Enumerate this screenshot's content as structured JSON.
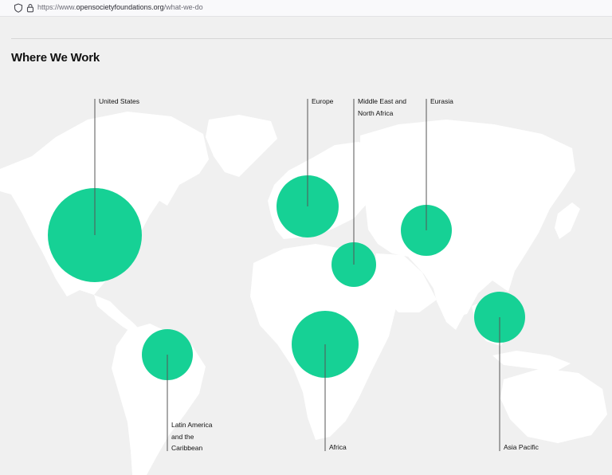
{
  "browser": {
    "url_prefix": "https://www.",
    "url_host": "opensocietyfoundations.org",
    "url_path": "/what-we-do",
    "shield_icon": "shield-icon",
    "lock_icon": "lock-icon"
  },
  "page": {
    "title": "Where We Work"
  },
  "colors": {
    "background": "#f0f0f0",
    "land": "#ffffff",
    "region_circle": "#0ecf92",
    "leader_line": "#555555"
  },
  "regions": [
    {
      "name": "United States",
      "lines": [
        "United States"
      ]
    },
    {
      "name": "Europe",
      "lines": [
        "Europe"
      ]
    },
    {
      "name": "Middle East and North Africa",
      "lines": [
        "Middle East and",
        "North Africa"
      ]
    },
    {
      "name": "Eurasia",
      "lines": [
        "Eurasia"
      ]
    },
    {
      "name": "Asia Pacific",
      "lines": [
        "Asia Pacific"
      ]
    },
    {
      "name": "Africa",
      "lines": [
        "Africa"
      ]
    },
    {
      "name": "Latin America and the Caribbean",
      "lines": [
        "Latin America",
        "and the",
        "Caribbean"
      ]
    }
  ]
}
